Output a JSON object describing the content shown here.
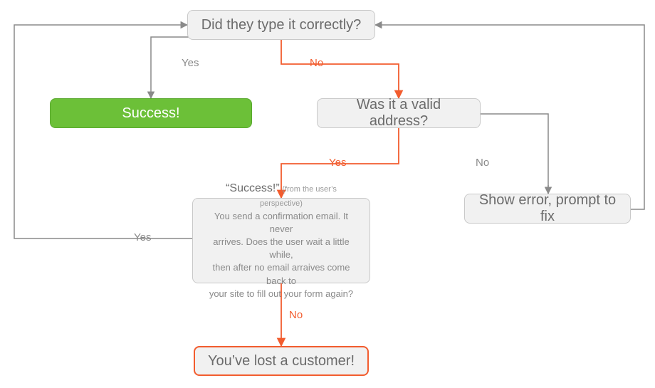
{
  "nodes": {
    "q_typed": {
      "text": "Did they type it correctly?"
    },
    "success": {
      "text": "Success!"
    },
    "q_valid": {
      "text": "Was it a valid address?"
    },
    "show_error": {
      "text": "Show error, prompt to fix"
    },
    "story": {
      "lead": "“Success!”",
      "perspective": "(from the user’s perspective)",
      "body1": "You send a confirmation email. It never",
      "body2": "arrives. Does the user wait a little while,",
      "body3": "then after no email arraives come back to",
      "body4": "your site to fill out your form again?"
    },
    "lost": {
      "text": "You’ve lost a customer!"
    }
  },
  "labels": {
    "typed_yes": "Yes",
    "typed_no": "No",
    "valid_yes": "Yes",
    "valid_no": "No",
    "story_yes": "Yes",
    "story_no": "No"
  },
  "colors": {
    "grey": "#8a8a8a",
    "red": "#f25c2e",
    "green": "#6cc038"
  }
}
